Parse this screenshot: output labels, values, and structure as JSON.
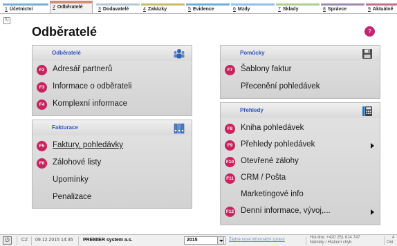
{
  "tabs": [
    {
      "num": "1",
      "label": "Účetnictví",
      "color": "#7aaed8"
    },
    {
      "num": "2",
      "label": "Odběratelé",
      "color": "#d08d7a",
      "active": true
    },
    {
      "num": "3",
      "label": "Dodavatelé",
      "color": "#b4c8d8"
    },
    {
      "num": "4",
      "label": "Zakázky",
      "color": "#c9b86a"
    },
    {
      "num": "5",
      "label": "Evidence",
      "color": "#6aaee0"
    },
    {
      "num": "6",
      "label": "Mzdy",
      "color": "#8fc0e8"
    },
    {
      "num": "7",
      "label": "Sklady",
      "color": "#a8d090"
    },
    {
      "num": "8",
      "label": "Správce",
      "color": "#9a8ab8"
    },
    {
      "num": "9",
      "label": "Aktuálně",
      "color": "#c86a8a"
    }
  ],
  "page": {
    "title": "Odběratelé",
    "corner_glyph": "↻",
    "help_glyph": "?"
  },
  "panels": {
    "odberatele": {
      "title": "Odběratelé",
      "icon": "users-icon",
      "items": [
        {
          "key": "F2",
          "label": "Adresář partnerů"
        },
        {
          "key": "F3",
          "label": "Informace o odběrateli"
        },
        {
          "key": "F4",
          "label": "Komplexní informace"
        }
      ]
    },
    "fakturace": {
      "title": "Fakturace",
      "icon": "binders-icon",
      "items": [
        {
          "key": "F5",
          "label": "Faktury, pohledávky"
        },
        {
          "key": "F6",
          "label": "Zálohové listy"
        },
        {
          "key": "",
          "label": "Upomínky"
        },
        {
          "key": "",
          "label": "Penalizace"
        }
      ]
    },
    "pomucky": {
      "title": "Pomůcky",
      "icon": "save-disk-icon",
      "items": [
        {
          "key": "F7",
          "label": "Šablony faktur"
        },
        {
          "key": "",
          "label": "Přecenění pohledávek"
        }
      ]
    },
    "prehledy": {
      "title": "Přehledy",
      "icon": "calculator-icon",
      "items": [
        {
          "key": "F8",
          "label": "Kniha pohledávek"
        },
        {
          "key": "F9",
          "label": "Přehledy pohledávek"
        },
        {
          "key": "F10",
          "label": "Otevřené zálohy"
        },
        {
          "key": "F11",
          "label": "CRM / Pošta"
        },
        {
          "key": "",
          "label": "Marketingové info"
        },
        {
          "key": "F12",
          "label": "Denní informace, vývoj,..."
        }
      ]
    }
  },
  "statusbar": {
    "power_glyph": "⏻",
    "lang": "CZ",
    "datetime": "09.12.2015 14:35",
    "company": "PREMIER system a.s.",
    "year": "2015",
    "news": "Žádné nové informační zprávy",
    "hotline_line1": "Hot-line: +420 251 614 747",
    "hotline_line2": "Náměty / Hlášení chyb",
    "trailing_top": "4",
    "trailing_bottom": "Onl"
  },
  "colors": {
    "key_badge": "#c8235e",
    "panel_title": "#2e56b8",
    "help": "#c52471"
  }
}
